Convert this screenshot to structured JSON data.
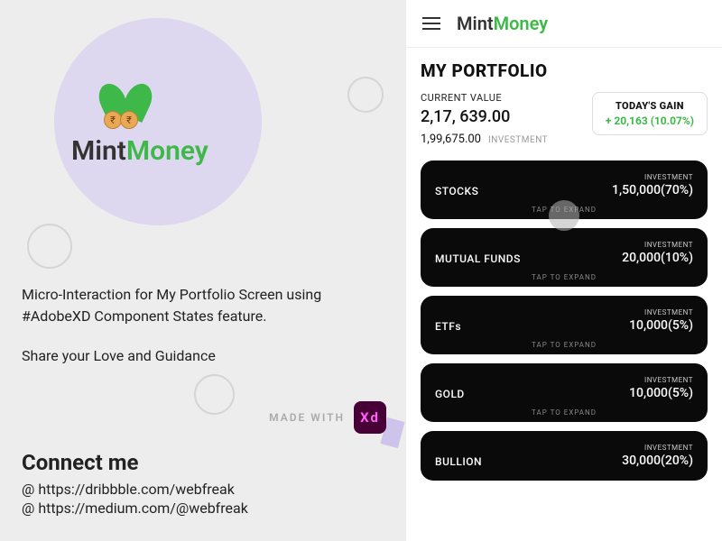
{
  "logo": {
    "mint": "Mint",
    "money": "Money"
  },
  "left": {
    "description": "Micro-Interaction for My Portfolio Screen using #AdobeXD Component States feature.",
    "share": "Share your Love and Guidance",
    "made_with": "MADE WITH",
    "xd": "Xd",
    "connect_title": "Connect me",
    "links": [
      "@ https://dribbble.com/webfreak",
      "@ https://medium.com/@webfreak"
    ]
  },
  "app": {
    "portfolio_title": "MY PORTFOLIO",
    "current_value_label": "CURRENT VALUE",
    "current_value": "2,17, 639.00",
    "investment_value": "1,99,675.00",
    "investment_label": "INVESTMENT",
    "gain_label": "TODAY'S GAIN",
    "gain_value": "+ 20,163 (10.07%)",
    "tap_hint": "TAP TO EXPAND",
    "inv_label": "INVESTMENT",
    "cards": [
      {
        "name": "STOCKS",
        "value": "1,50,000(70%)"
      },
      {
        "name": "MUTUAL FUNDS",
        "value": "20,000(10%)"
      },
      {
        "name": "ETFs",
        "value": "10,000(5%)"
      },
      {
        "name": "GOLD",
        "value": "10,000(5%)"
      },
      {
        "name": "BULLION",
        "value": "30,000(20%)"
      }
    ]
  }
}
